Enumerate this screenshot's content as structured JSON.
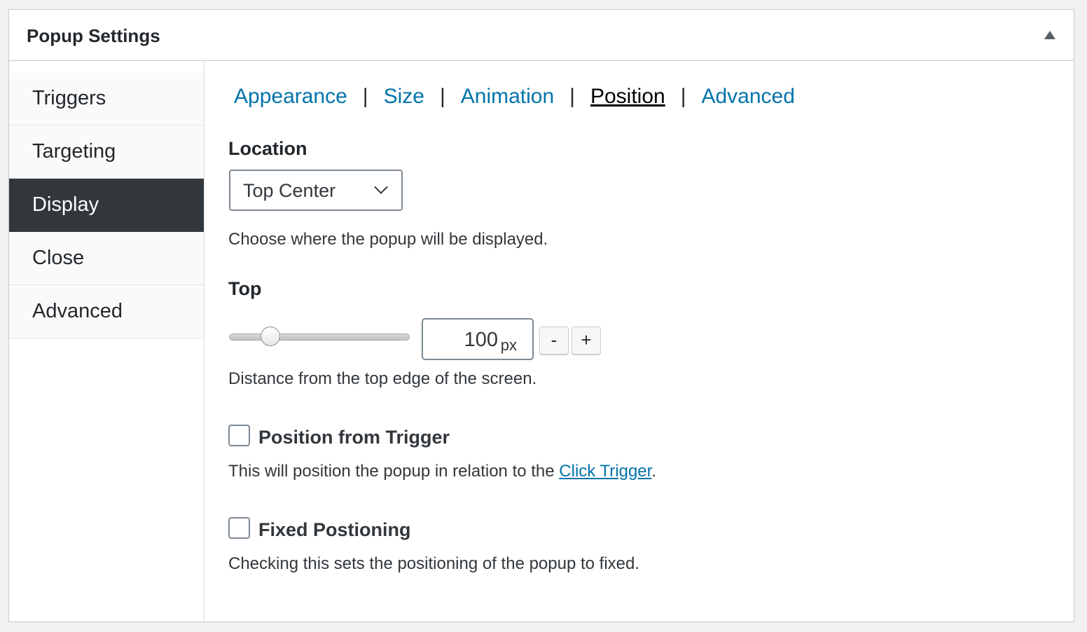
{
  "header": {
    "title": "Popup Settings"
  },
  "sidebar": {
    "items": [
      {
        "label": "Triggers",
        "active": false
      },
      {
        "label": "Targeting",
        "active": false
      },
      {
        "label": "Display",
        "active": true
      },
      {
        "label": "Close",
        "active": false
      },
      {
        "label": "Advanced",
        "active": false
      }
    ]
  },
  "subtabs": {
    "items": [
      {
        "label": "Appearance",
        "current": false
      },
      {
        "label": "Size",
        "current": false
      },
      {
        "label": "Animation",
        "current": false
      },
      {
        "label": "Position",
        "current": true
      },
      {
        "label": "Advanced",
        "current": false
      }
    ],
    "separator": "|"
  },
  "location": {
    "label": "Location",
    "selected": "Top Center",
    "description": "Choose where the popup will be displayed."
  },
  "top": {
    "label": "Top",
    "value": "100",
    "unit": "px",
    "slider_fraction": 0.23,
    "minus_label": "-",
    "plus_label": "+",
    "description": "Distance from the top edge of the screen."
  },
  "position_from_trigger": {
    "label": "Position from Trigger",
    "checked": false,
    "description_prefix": "This will position the popup in relation to the ",
    "link_text": "Click Trigger",
    "description_suffix": "."
  },
  "fixed_positioning": {
    "label": "Fixed Postioning",
    "checked": false,
    "description": "Checking this sets the positioning of the popup to fixed."
  },
  "colors": {
    "link": "#0073aa",
    "active_tab_bg": "#32373c",
    "active_tab_text": "#ffffff"
  }
}
